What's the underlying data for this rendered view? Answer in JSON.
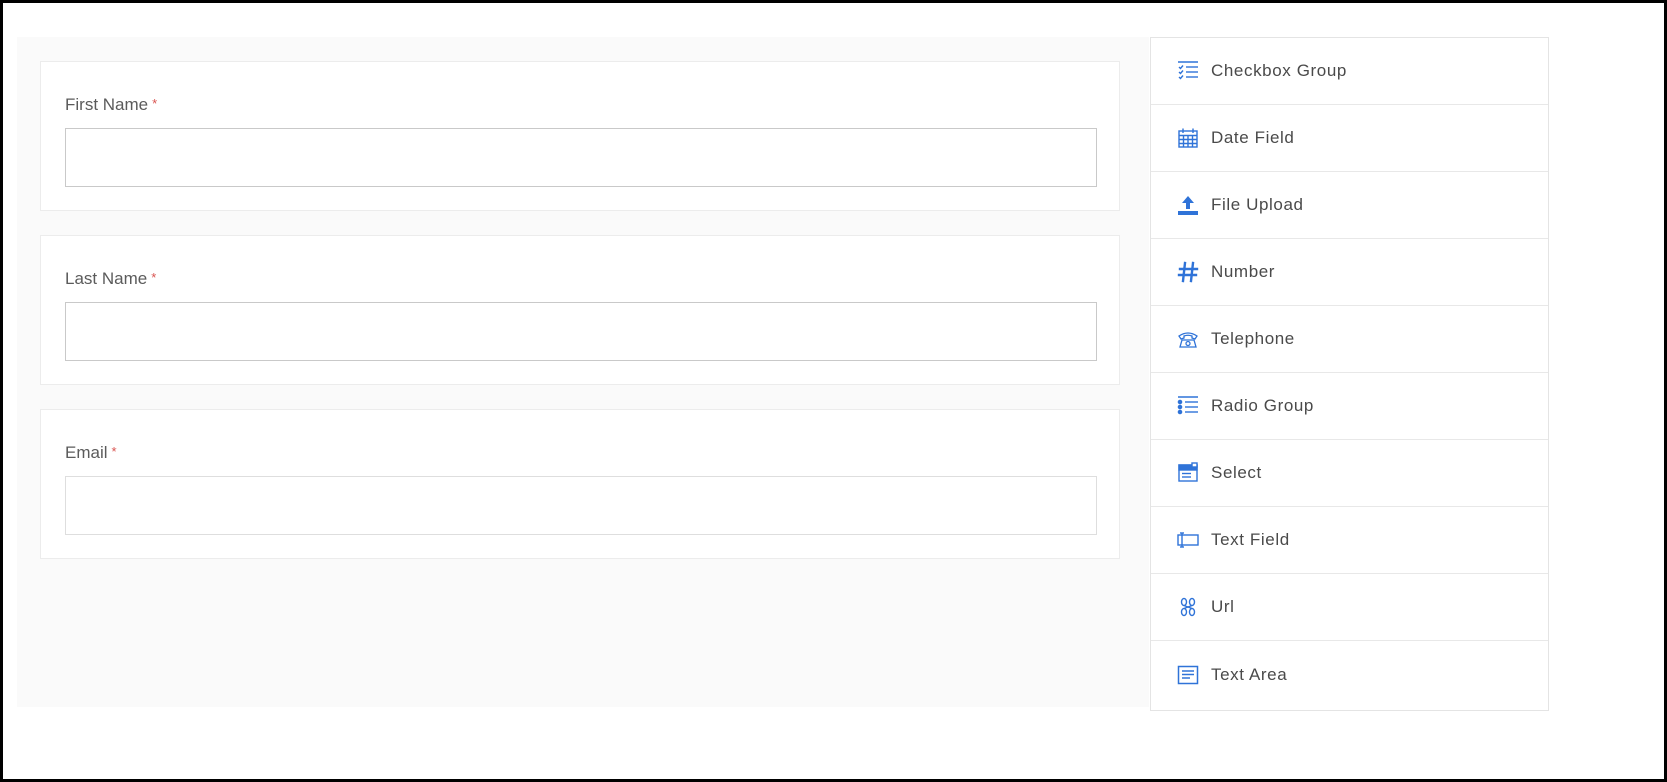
{
  "form": {
    "fields": [
      {
        "label": "First Name",
        "required_mark": "*",
        "value": ""
      },
      {
        "label": "Last Name",
        "required_mark": "*",
        "value": ""
      },
      {
        "label": "Email",
        "required_mark": "*",
        "value": ""
      }
    ]
  },
  "palette": {
    "accent_color": "#2f73d8",
    "items": [
      {
        "label": "Checkbox Group",
        "icon": "checkbox-list-icon"
      },
      {
        "label": "Date Field",
        "icon": "calendar-icon"
      },
      {
        "label": "File Upload",
        "icon": "upload-icon"
      },
      {
        "label": "Number",
        "icon": "hash-icon"
      },
      {
        "label": "Telephone",
        "icon": "telephone-icon"
      },
      {
        "label": "Radio Group",
        "icon": "radio-list-icon"
      },
      {
        "label": "Select",
        "icon": "select-icon"
      },
      {
        "label": "Text Field",
        "icon": "text-field-icon"
      },
      {
        "label": "Url",
        "icon": "link-icon"
      },
      {
        "label": "Text Area",
        "icon": "text-area-icon"
      }
    ]
  }
}
